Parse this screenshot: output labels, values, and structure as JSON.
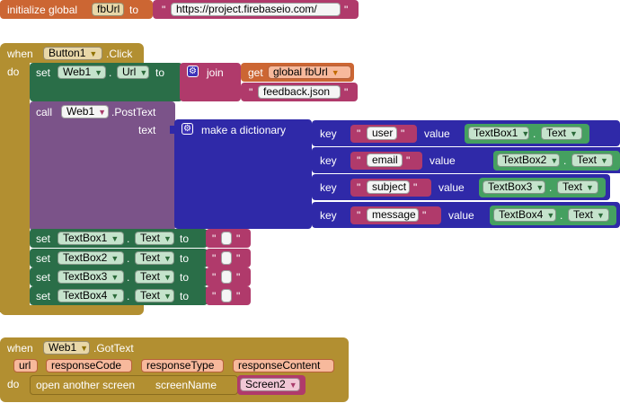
{
  "global_block": {
    "initialize_label": "initialize global",
    "var_name": "fbUrl",
    "to_label": "to",
    "quote_open": "\"",
    "url_value": "https://project.firebaseio.com/",
    "quote_close": "\""
  },
  "click_event": {
    "when_label": "when",
    "component": "Button1",
    "event": ".Click",
    "do_label": "do",
    "set_url": {
      "set_label": "set",
      "component": "Web1",
      "dot": ".",
      "property": "Url",
      "to_label": "to",
      "join_label": "join",
      "get_label": "get",
      "get_var": "global fbUrl",
      "text_value": "feedback.json",
      "quote": "\""
    },
    "post_call": {
      "call_label": "call",
      "component": "Web1",
      "method": ".PostText",
      "text_label": "text",
      "dict_label": "make a dictionary",
      "pairs": [
        {
          "key_label": "key",
          "key_text": "user",
          "value_label": "value",
          "component": "TextBox1",
          "dot": ".",
          "property": "Text"
        },
        {
          "key_label": "key",
          "key_text": "email",
          "value_label": "value",
          "component": "TextBox2",
          "dot": ".",
          "property": "Text"
        },
        {
          "key_label": "key",
          "key_text": "subject",
          "value_label": "value",
          "component": "TextBox3",
          "dot": ".",
          "property": "Text"
        },
        {
          "key_label": "key",
          "key_text": "message",
          "value_label": "value",
          "component": "TextBox4",
          "dot": ".",
          "property": "Text"
        }
      ]
    },
    "clear_sets": [
      {
        "set_label": "set",
        "component": "TextBox1",
        "dot": ".",
        "property": "Text",
        "to_label": "to",
        "quote": "\""
      },
      {
        "set_label": "set",
        "component": "TextBox2",
        "dot": ".",
        "property": "Text",
        "to_label": "to",
        "quote": "\""
      },
      {
        "set_label": "set",
        "component": "TextBox3",
        "dot": ".",
        "property": "Text",
        "to_label": "to",
        "quote": "\""
      },
      {
        "set_label": "set",
        "component": "TextBox4",
        "dot": ".",
        "property": "Text",
        "to_label": "to",
        "quote": "\""
      }
    ]
  },
  "gottext_event": {
    "when_label": "when",
    "component": "Web1",
    "event": ".GotText",
    "params": [
      "url",
      "responseCode",
      "responseType",
      "responseContent"
    ],
    "do_label": "do",
    "open_screen_label": "open another screen",
    "screen_name_label": "screenName",
    "screen_value": "Screen2"
  },
  "colors": {
    "variables": "#cc6633",
    "text": "#b03a6b",
    "setters": "#2a6e48",
    "events": "#b28f31",
    "web_call": "#7b5389",
    "dictionary": "#2f29a8",
    "textbox_getter": "#45a060"
  },
  "icons": {
    "dropdown": "▼",
    "gear": "⚙"
  }
}
